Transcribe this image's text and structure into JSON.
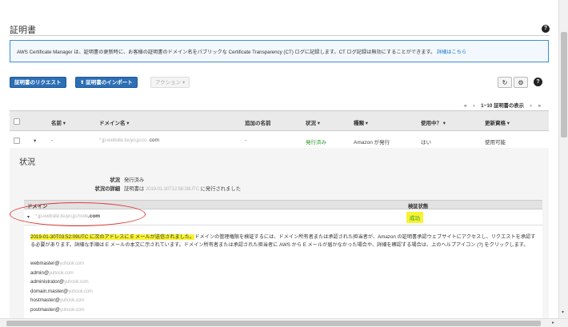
{
  "header": {
    "title": "証明書",
    "help_icon": "?"
  },
  "info": {
    "text": "AWS Certificate Manager は、証明書の更新時に、お客様の証明書のドメイン名をパブリックな Certificate Transparency (CT) ログに記録します。CT ログ記録は無効にすることができます。",
    "link": "詳細はこちら"
  },
  "toolbar": {
    "request_label": "証明書のリクエスト",
    "import_label": "証明書のインポート",
    "import_icon": "⬆",
    "actions_label": "アクション ▾",
    "refresh_icon": "↻",
    "settings_icon": "⚙",
    "help_icon": "?"
  },
  "pager": {
    "first": "«",
    "prev": "‹",
    "range": "1~10 証明書の表示",
    "next": "›",
    "last": "»"
  },
  "table": {
    "headers": {
      "name": "名前 ▾",
      "domain": "ドメイン名 ▾",
      "extra": "追加の名前",
      "status": "状況 ▾",
      "type": "種類 ▾",
      "in_use": "使用中？ ▾",
      "renew": "更新資格 ▾"
    },
    "row": {
      "expand": "▾",
      "name": "-",
      "domain_blur": "*.jp-website.tsuyo.jp.co.",
      "domain_suffix": "com",
      "extra": "-",
      "status": "発行済み",
      "type": "Amazon が発行",
      "in_use": "はい",
      "renew": "使用可能"
    }
  },
  "detail": {
    "title": "状況",
    "status_key": "状況",
    "status_value": "発行済み",
    "detail_key": "状況の詳細",
    "detail_prefix": "証明書は",
    "detail_blur": "2019-01-30T12:56:38UTC",
    "detail_suffix": "に発行されました",
    "domain_col": "ドメイン",
    "verify_col": "検証状態",
    "domain_blur": "*.jp-website.tsuyo.jp.hook",
    "domain_suffix": ".com",
    "verify_value": "成功",
    "message_highlight": "2019-01-30T03:52:09UTC に次のアドレスに E メールが送信されました。",
    "message_rest": "ドメインの管理権限を検証するには、ドメイン所有者または承認された担当者が、Amazon の証明書承認ウェブサイトにアクセスし、リクエストを承認する必要があります。詳細な手順は E メールの本文に示されています。ドメイン所有者または承認された担当者に AWS から E メールが届かなかった場合や、詳細を確認する場合は、上のヘルプアイコン (?) をクリックします。",
    "emails": [
      {
        "prefix": "webmaster@",
        "blur": "yuhook.com"
      },
      {
        "prefix": "admin@",
        "blur": "yuhook.com"
      },
      {
        "prefix": "administrator@",
        "blur": "yuhook.com"
      },
      {
        "prefix": "domain.master@",
        "blur": "yuhook.com"
      },
      {
        "prefix": "hostmaster@",
        "blur": "yuhook.com"
      },
      {
        "prefix": "postmaster@",
        "blur": "yuhook.com"
      }
    ]
  },
  "colors": {
    "primary": "#2c6fb5",
    "success": "#2b9a2b",
    "highlight": "#f7f232",
    "annotation": "#e03a3a",
    "info_border": "#3b8fd6"
  }
}
